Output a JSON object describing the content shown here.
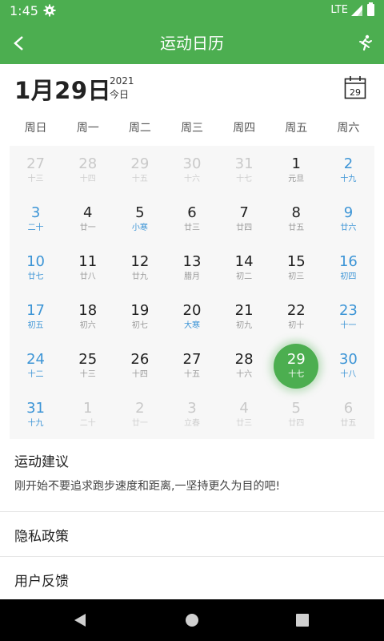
{
  "status_bar": {
    "time": "1:45",
    "network": "LTE"
  },
  "app_bar": {
    "title": "运动日历"
  },
  "date_header": {
    "big_date": "1月29日",
    "year": "2021",
    "today": "今日",
    "calendar_icon_day": "29"
  },
  "weekdays": [
    "周日",
    "周一",
    "周二",
    "周三",
    "周四",
    "周五",
    "周六"
  ],
  "calendar": {
    "month": "2021-01",
    "selected_day": "29",
    "days": [
      {
        "day": "27",
        "lunar": "十三",
        "muted": true
      },
      {
        "day": "28",
        "lunar": "十四",
        "muted": true
      },
      {
        "day": "29",
        "lunar": "十五",
        "muted": true
      },
      {
        "day": "30",
        "lunar": "十六",
        "muted": true
      },
      {
        "day": "31",
        "lunar": "十七",
        "muted": true
      },
      {
        "day": "1",
        "lunar": "元旦"
      },
      {
        "day": "2",
        "lunar": "十九"
      },
      {
        "day": "3",
        "lunar": "二十"
      },
      {
        "day": "4",
        "lunar": "廿一"
      },
      {
        "day": "5",
        "lunar": "小寒",
        "festival": true
      },
      {
        "day": "6",
        "lunar": "廿三"
      },
      {
        "day": "7",
        "lunar": "廿四"
      },
      {
        "day": "8",
        "lunar": "廿五"
      },
      {
        "day": "9",
        "lunar": "廿六"
      },
      {
        "day": "10",
        "lunar": "廿七"
      },
      {
        "day": "11",
        "lunar": "廿八"
      },
      {
        "day": "12",
        "lunar": "廿九"
      },
      {
        "day": "13",
        "lunar": "腊月"
      },
      {
        "day": "14",
        "lunar": "初二"
      },
      {
        "day": "15",
        "lunar": "初三"
      },
      {
        "day": "16",
        "lunar": "初四"
      },
      {
        "day": "17",
        "lunar": "初五"
      },
      {
        "day": "18",
        "lunar": "初六"
      },
      {
        "day": "19",
        "lunar": "初七"
      },
      {
        "day": "20",
        "lunar": "大寒",
        "festival": true
      },
      {
        "day": "21",
        "lunar": "初九"
      },
      {
        "day": "22",
        "lunar": "初十"
      },
      {
        "day": "23",
        "lunar": "十一"
      },
      {
        "day": "24",
        "lunar": "十二"
      },
      {
        "day": "25",
        "lunar": "十三"
      },
      {
        "day": "26",
        "lunar": "十四"
      },
      {
        "day": "27",
        "lunar": "十五"
      },
      {
        "day": "28",
        "lunar": "十六"
      },
      {
        "day": "29",
        "lunar": "十七",
        "selected": true
      },
      {
        "day": "30",
        "lunar": "十八"
      },
      {
        "day": "31",
        "lunar": "十九"
      },
      {
        "day": "1",
        "lunar": "二十",
        "muted": true
      },
      {
        "day": "2",
        "lunar": "廿一",
        "muted": true
      },
      {
        "day": "3",
        "lunar": "立春",
        "muted": true
      },
      {
        "day": "4",
        "lunar": "廿三",
        "muted": true
      },
      {
        "day": "5",
        "lunar": "廿四",
        "muted": true
      },
      {
        "day": "6",
        "lunar": "廿五",
        "muted": true
      }
    ]
  },
  "advice": {
    "title": "运动建议",
    "text": "刚开始不要追求跑步速度和距离,一坚持更久为目的吧!"
  },
  "menu": [
    {
      "label": "隐私政策"
    },
    {
      "label": "用户反馈"
    }
  ],
  "colors": {
    "primary": "#4cae50",
    "weekend": "#3d95d6",
    "muted": "#c9c9c9"
  },
  "icons": {
    "status": [
      "gear-icon",
      "signal-icon",
      "battery-icon"
    ],
    "app_bar": [
      "back-arrow-icon",
      "runner-icon"
    ],
    "header": [
      "calendar-icon"
    ],
    "nav": [
      "back-triangle-icon",
      "home-circle-icon",
      "recents-square-icon"
    ]
  }
}
